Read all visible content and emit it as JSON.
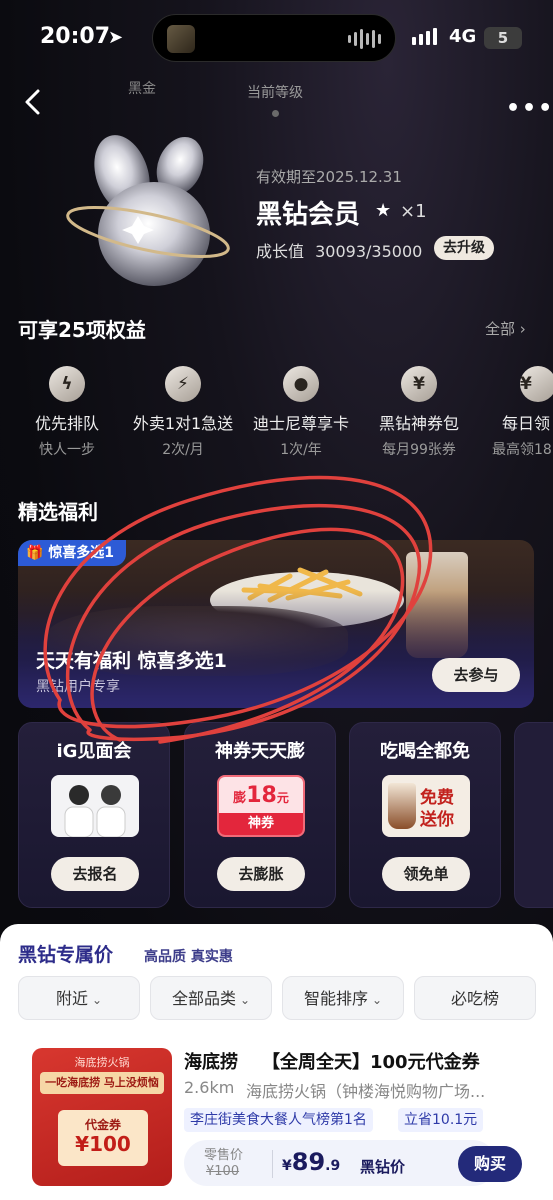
{
  "status_bar": {
    "time": "20:07",
    "network": "4G",
    "battery": "5"
  },
  "header": {
    "tabs": [
      {
        "label": "黑金"
      },
      {
        "label": "当前等级"
      }
    ]
  },
  "level": {
    "valid_until": "有效期至2025.12.31",
    "name": "黑钻会员",
    "multiplier": "×1",
    "growth_label": "成长值",
    "growth_value": "30093/35000",
    "upgrade_label": "去升级"
  },
  "benefits": {
    "title": "可享25项权益",
    "all_label": "全部",
    "items": [
      {
        "icon": "lightning-icon",
        "glyph": "ϟ",
        "name": "优先排队",
        "sub": "快人一步"
      },
      {
        "icon": "delivery-bike-icon",
        "glyph": "⚡",
        "name": "外卖1对1急送",
        "sub": "2次/月"
      },
      {
        "icon": "mickey-icon",
        "glyph": "●",
        "name": "迪士尼尊享卡",
        "sub": "1次/年"
      },
      {
        "icon": "money-bag-icon",
        "glyph": "¥",
        "name": "黑钻神券包",
        "sub": "每月99张券"
      },
      {
        "icon": "calendar-yen-icon",
        "glyph": "¥",
        "name": "每日领",
        "sub": "最高领18"
      }
    ]
  },
  "featured": {
    "title": "精选福利",
    "banner": {
      "tag": "惊喜多选1",
      "title": "天天有福利 惊喜多选1",
      "subtitle": "黑钻用户专享",
      "button": "去参与"
    },
    "cards": [
      {
        "title": "iG见面会",
        "button": "去报名"
      },
      {
        "title": "神券天天膨",
        "button": "去膨胀",
        "coupon_prefix": "膨",
        "coupon_value": "18",
        "coupon_unit": "元",
        "coupon_label": "神券"
      },
      {
        "title": "吃喝全都免",
        "button": "领免单",
        "image_text_1": "免费",
        "image_text_2": "送你"
      }
    ]
  },
  "exclusive": {
    "title": "黑钻专属价",
    "subtitle": "高品质 真实惠",
    "filters": [
      "附近",
      "全部品类",
      "智能排序",
      "必吃榜"
    ],
    "deal": {
      "shop": "海底捞",
      "title": "【全周全天】100元代金券",
      "distance": "2.6km",
      "address": "海底捞火锅（钟楼海悦购物广场...",
      "tags": [
        "李庄街美食大餐人气榜第1名",
        "立省10.1元"
      ],
      "retail_label": "零售价",
      "retail_price": "¥100",
      "price_symbol": "¥",
      "price_int": "89",
      "price_dec": ".9",
      "price_suffix": "黑钻价",
      "buy_label": "购买",
      "image_brand": "海底捞火锅",
      "image_slogan": "一吃海底捞 马上没烦恼",
      "image_coupon_label": "代金券",
      "image_coupon_value": "¥100"
    }
  },
  "colors": {
    "accent": "#232a7a",
    "annotation": "#e0413d",
    "banner_tag": "#2d5bd6"
  }
}
